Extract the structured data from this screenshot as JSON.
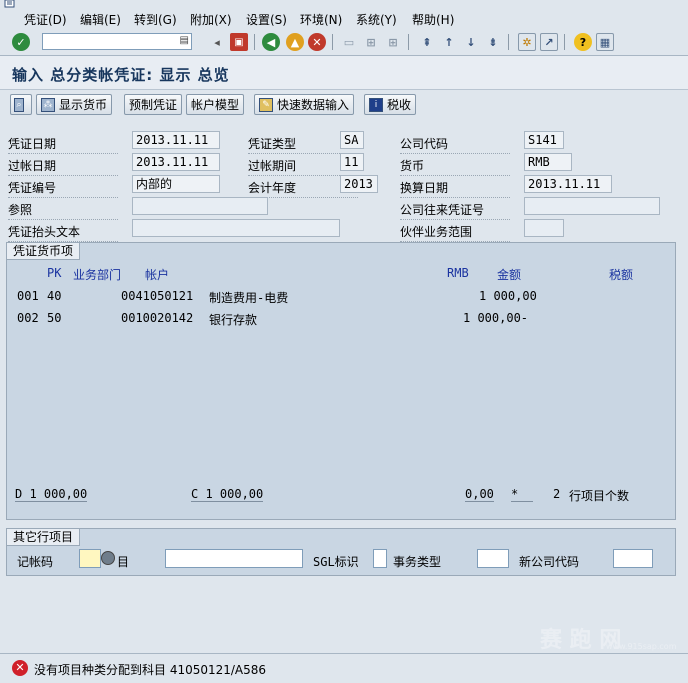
{
  "menu": [
    "凭证(D)",
    "编辑(E)",
    "转到(G)",
    "附加(X)",
    "设置(S)",
    "环境(N)",
    "系统(Y)",
    "帮助(H)"
  ],
  "page_title": "输入 总分类帐凭证: 显示 总览",
  "app_toolbar": {
    "show_currency": "显示货币",
    "park": "预制凭证",
    "acct_model": "帐户模型",
    "fast_entry": "快速数据输入",
    "tax": "税收"
  },
  "header": {
    "doc_date_label": "凭证日期",
    "doc_date": "2013.11.11",
    "doc_type_label": "凭证类型",
    "doc_type": "SA",
    "company_code_label": "公司代码",
    "company_code": "S141",
    "posting_date_label": "过帐日期",
    "posting_date": "2013.11.11",
    "period_label": "过帐期间",
    "period": "11",
    "currency_label": "货币",
    "currency": "RMB",
    "doc_no_label": "凭证编号",
    "doc_no": "内部的",
    "fiscal_year_label": "会计年度",
    "fiscal_year": "2013",
    "translation_date_label": "换算日期",
    "translation_date": "2013.11.11",
    "reference_label": "参照",
    "intercompany_label": "公司往来凭证号",
    "header_text_label": "凭证抬头文本",
    "trading_partner_label": "伙伴业务范围"
  },
  "items_group": {
    "title": "凭证货币项",
    "col_pk": "PK",
    "col_bus": "业务部门",
    "col_acct": "帐户",
    "col_cur": "RMB",
    "col_amount": "金额",
    "col_tax": "税额",
    "rows": [
      {
        "line": "001",
        "pk": "40",
        "account": "0041050121",
        "desc": "制造费用-电费",
        "amount": "1 000,00"
      },
      {
        "line": "002",
        "pk": "50",
        "account": "0010020142",
        "desc": "银行存款",
        "amount": "1 000,00-"
      }
    ],
    "totals": {
      "debit": "D 1 000,00",
      "credit": "C 1 000,00",
      "balance": "0,00",
      "star": "*",
      "item_count": "2",
      "item_count_label": "行项目个数"
    }
  },
  "other_group": {
    "title": "其它行项目",
    "posting_key_label": "记帐码",
    "account_label": "目",
    "sgl_label": "SGL标识",
    "trans_type_label": "事务类型",
    "new_cc_label": "新公司代码"
  },
  "status": {
    "message": "没有项目种类分配到科目 41050121/A586",
    "error_color": "#d0202a"
  },
  "watermark": {
    "text": "赛 跑 网",
    "url": "www.915sap.com"
  }
}
